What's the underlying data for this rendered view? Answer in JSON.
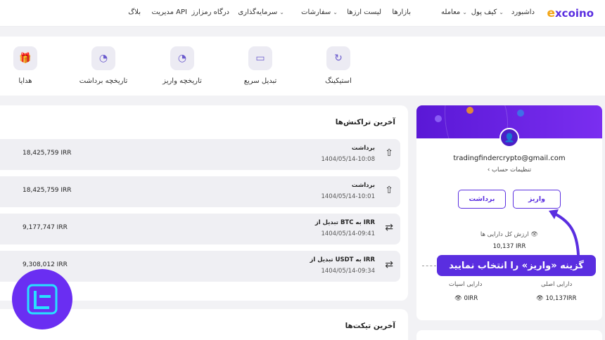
{
  "brand": {
    "logo_e": "e",
    "logo_rest": "xcoino",
    "accent": "#5a2ee0"
  },
  "nav": {
    "dashboard": "داشبورد",
    "wallet": "کیف پول",
    "trade": "معامله",
    "markets": "بازارها",
    "currency_list": "لیست ارزها",
    "orders": "سفارشات",
    "investment": "سرمایه‌گذاری",
    "crypto_gateway": "درگاه رمزارز",
    "api_management": "مدیریت API",
    "blog": "بلاگ"
  },
  "shortcuts": {
    "staking": "استیکینگ",
    "quick_swap": "تبدیل سریع",
    "deposit_history": "تاریخچه واریز",
    "withdraw_history": "تاریخچه برداشت",
    "gifts": "هدایا"
  },
  "transactions": {
    "title": "آخرین تراکنش‌ها",
    "items": [
      {
        "type": "برداشت",
        "date": "1404/05/14-10:08",
        "amount": "18,425,759 IRR",
        "icon": "upload-icon"
      },
      {
        "type": "برداشت",
        "date": "1404/05/14-10:01",
        "amount": "18,425,759 IRR",
        "icon": "upload-icon"
      },
      {
        "type": "تبدیل از BTC به IRR",
        "date": "1404/05/14-09:41",
        "amount": "9,177,747 IRR",
        "icon": "swap-icon"
      },
      {
        "type": "تبدیل از USDT به IRR",
        "date": "1404/05/14-09:34",
        "amount": "9,308,012 IRR",
        "icon": "swap-icon"
      }
    ]
  },
  "tickets": {
    "title": "آخرین تیکت‌ها"
  },
  "profile": {
    "email": "tradingfindercrypto@gmail.com",
    "settings": "تنظیمات حساب",
    "deposit": "واریز",
    "withdraw": "برداشت",
    "total_assets_label": "ارزش کل دارایی ها",
    "total_assets_value": "10,137 IRR",
    "main_assets_label": "دارایی اصلی",
    "main_assets_value": "10,137IRR",
    "spot_assets_label": "دارایی اسپات",
    "spot_assets_value": "0IRR"
  },
  "callout": {
    "text": "گزینه «واریز» را انتخاب نمایید"
  }
}
